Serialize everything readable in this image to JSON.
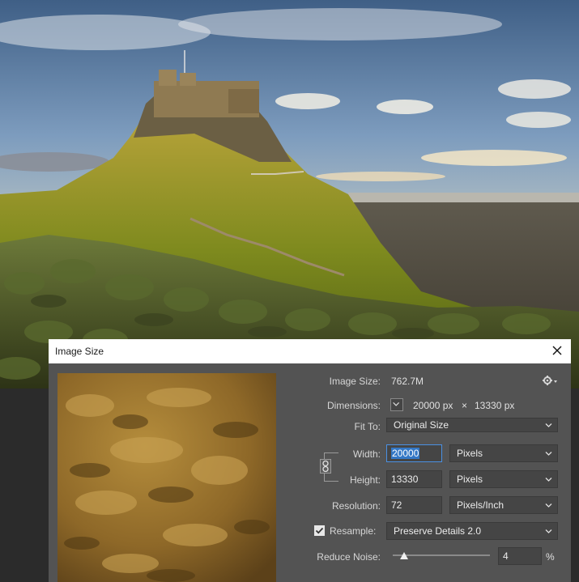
{
  "dialog": {
    "title": "Image Size",
    "image_size_label": "Image Size:",
    "image_size_value": "762.7M",
    "dimensions_label": "Dimensions:",
    "dimensions_width": "20000 px",
    "dimensions_x": "×",
    "dimensions_height": "13330 px",
    "fit_to_label": "Fit To:",
    "fit_to_value": "Original Size",
    "width_label": "Width:",
    "width_value": "20000",
    "width_unit": "Pixels",
    "height_label": "Height:",
    "height_value": "13330",
    "height_unit": "Pixels",
    "resolution_label": "Resolution:",
    "resolution_value": "72",
    "resolution_unit": "Pixels/Inch",
    "resample_label": "Resample:",
    "resample_checked": true,
    "resample_value": "Preserve Details 2.0",
    "reduce_noise_label": "Reduce Noise:",
    "reduce_noise_value": "4",
    "reduce_noise_unit": "%",
    "reduce_noise_level": 0.04
  },
  "icons": {
    "close": "close-icon",
    "settings": "gear-icon",
    "link": "chain-link-icon",
    "dropdown": "chevron-down-icon",
    "checkbox": "checkbox-icon"
  },
  "colors": {
    "dialog_bg": "#535353",
    "field_bg": "#454545",
    "focus": "#4a90e2",
    "text_selection": "#3478c6"
  }
}
